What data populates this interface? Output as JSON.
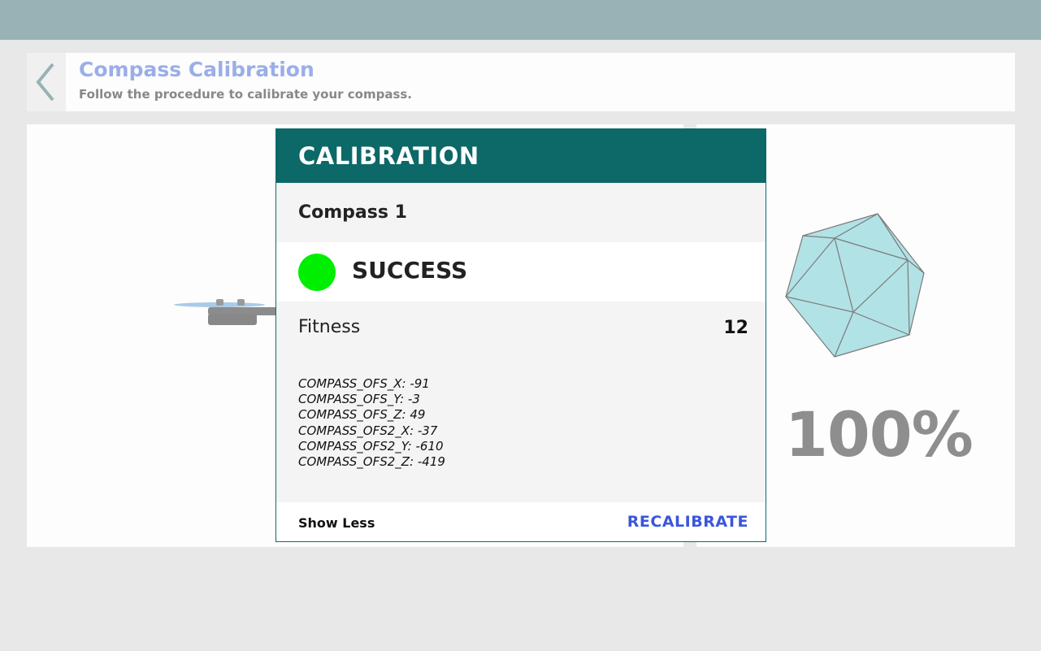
{
  "header": {
    "title": "Compass Calibration",
    "subtitle": "Follow the procedure to calibrate your compass.",
    "back_icon": "chevron-left-icon"
  },
  "card": {
    "title": "CALIBRATION",
    "compass_name": "Compass 1",
    "status": "SUCCESS",
    "status_color": "#00ee00",
    "fitness_label": "Fitness",
    "fitness_value": "12",
    "params": [
      "COMPASS_OFS_X: -91",
      "COMPASS_OFS_Y: -3",
      "COMPASS_OFS_Z: 49",
      "COMPASS_OFS2_X: -37",
      "COMPASS_OFS2_Y: -610",
      "COMPASS_OFS2_Z: -419"
    ],
    "show_less_label": "Show Less",
    "recalibrate_label": "RECALIBRATE"
  },
  "progress": {
    "percent_text": "100%",
    "value": 1.0
  },
  "colors": {
    "topbar": "#98b2b5",
    "card_header": "#0d6868",
    "title_accent": "#9aaee8",
    "action": "#3a56dc"
  }
}
